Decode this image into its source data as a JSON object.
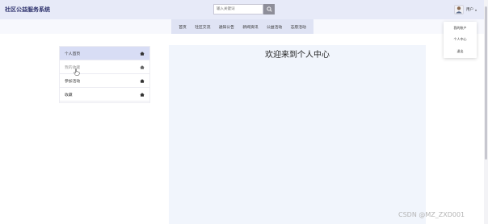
{
  "header": {
    "brand": "社区公益服务系统",
    "search_placeholder": "输入关键词",
    "user_name": "用户"
  },
  "nav": {
    "items": [
      "首页",
      "社区交流",
      "通知公告",
      "新闻资讯",
      "公益活动",
      "志愿活动"
    ]
  },
  "dropdown": {
    "items": [
      "我的账户",
      "个人中心",
      "退出"
    ]
  },
  "sidebar": {
    "items": [
      {
        "label": "个人首页",
        "active": true
      },
      {
        "label": "我的收藏",
        "active": false,
        "muted": true
      },
      {
        "label": "参加活动",
        "active": false
      },
      {
        "label": "收藏",
        "active": false
      }
    ]
  },
  "main": {
    "title": "欢迎来到个人中心"
  },
  "watermark": "CSDN @MZ_ZXD001",
  "colors": {
    "header_bg": "#e7eaf8",
    "nav_bg": "#dfe3f4",
    "sidebar_active": "#d8ddf5",
    "panel_bg": "#f1f5fc",
    "brand_text": "#2b2f6b"
  }
}
